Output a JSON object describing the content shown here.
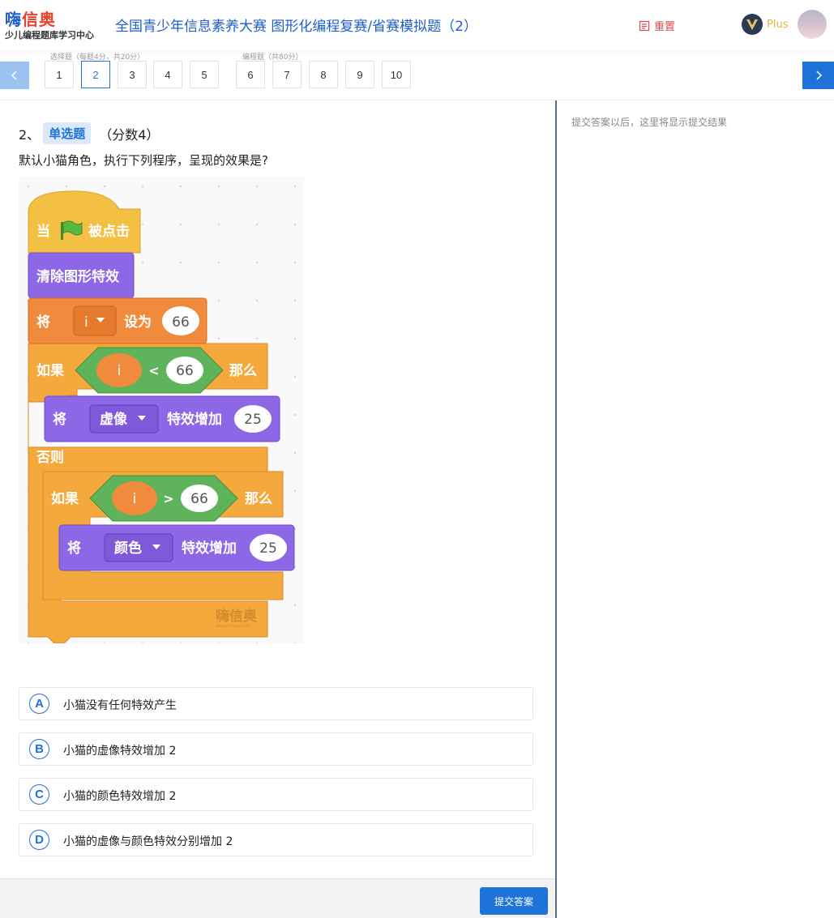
{
  "header": {
    "logo_main_1": "嗨",
    "logo_main_2": "信奥",
    "logo_sub": "少儿编程题库学习中心",
    "title": "全国青少年信息素养大赛 图形化编程复赛/省赛模拟题（2）",
    "reset_label": "重置",
    "plus_label": "Plus"
  },
  "nav": {
    "group1_label": "选择题（每题4分，共20分）",
    "group2_label": "编程题（共80分）",
    "questions": [
      "1",
      "2",
      "3",
      "4",
      "5",
      "6",
      "7",
      "8",
      "9",
      "10"
    ],
    "active_index": 1
  },
  "question": {
    "number": "2、",
    "type": "单选题",
    "score": "（分数4）",
    "text": "默认小猫角色，执行下列程序，呈现的效果是?",
    "blocks": {
      "when": "当",
      "clicked": "被点击",
      "clear_effects": "清除图形特效",
      "set": "将",
      "var": "i",
      "set_to": "设为",
      "value1": "66",
      "if": "如果",
      "then": "那么",
      "lt": "<",
      "gt": ">",
      "change": "将",
      "effect1": "虚像",
      "change_by": "特效增加",
      "amount": "25",
      "else": "否则",
      "effect2": "颜色",
      "watermark": "嗨信奥",
      "watermark_url": "www.hixinao.com"
    }
  },
  "options": [
    {
      "letter": "A",
      "text": "小猫没有任何特效产生"
    },
    {
      "letter": "B",
      "text": "小猫的虚像特效增加 2"
    },
    {
      "letter": "C",
      "text": "小猫的颜色特效增加 2"
    },
    {
      "letter": "D",
      "text": "小猫的虚像与颜色特效分别增加 2"
    }
  ],
  "submit_label": "提交答案",
  "result_hint": "提交答案以后，这里将显示提交结果",
  "colors": {
    "accent": "#1f73d8",
    "event_block": "#f4b84a",
    "looks_block": "#8c67e6",
    "variable_block": "#f08a3c",
    "control_block": "#f5a83c",
    "operator_block": "#5fb35a",
    "reset_red": "#e04a4a"
  },
  "icons": {
    "prev": "chevron-left-icon",
    "next": "chevron-right-icon",
    "reset": "reset-icon",
    "vip": "vip-badge-icon",
    "flag": "green-flag-icon"
  }
}
